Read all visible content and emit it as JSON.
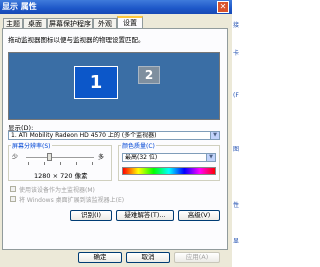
{
  "window": {
    "title": "显示 属性",
    "close_glyph": "✕"
  },
  "right_strip": {
    "items": [
      "接",
      "卡",
      "(F",
      "图",
      "性",
      "显"
    ]
  },
  "tabs": [
    "主题",
    "桌面",
    "屏幕保护程序",
    "外观",
    "设置"
  ],
  "active_tab": "设置",
  "instruction": "拖动监视器图标以便与监视器的物理设置匹配。",
  "monitors": [
    "1",
    "2"
  ],
  "display": {
    "label": "显示(D):",
    "value": "1. ATI Mobility Radeon HD 4570 上的 (多个监视器)"
  },
  "resolution": {
    "title": "屏幕分辨率(S)",
    "less": "少",
    "more": "多",
    "value_text": "1280 × 720 像素",
    "slider_level": 0.35
  },
  "color": {
    "title": "颜色质量(C)",
    "value": "最高(32 位)"
  },
  "checkboxes": [
    {
      "label": "使用该设备作为主监视器(M)",
      "checked": false
    },
    {
      "label": "将 Windows 桌面扩展到该监视器上(E)",
      "checked": false
    }
  ],
  "buttons": {
    "identify": "识别(I)",
    "troubleshoot": "疑难解答(T)...",
    "advanced": "高级(V)",
    "ok": "确定",
    "cancel": "取消",
    "apply": "应用(A)"
  }
}
